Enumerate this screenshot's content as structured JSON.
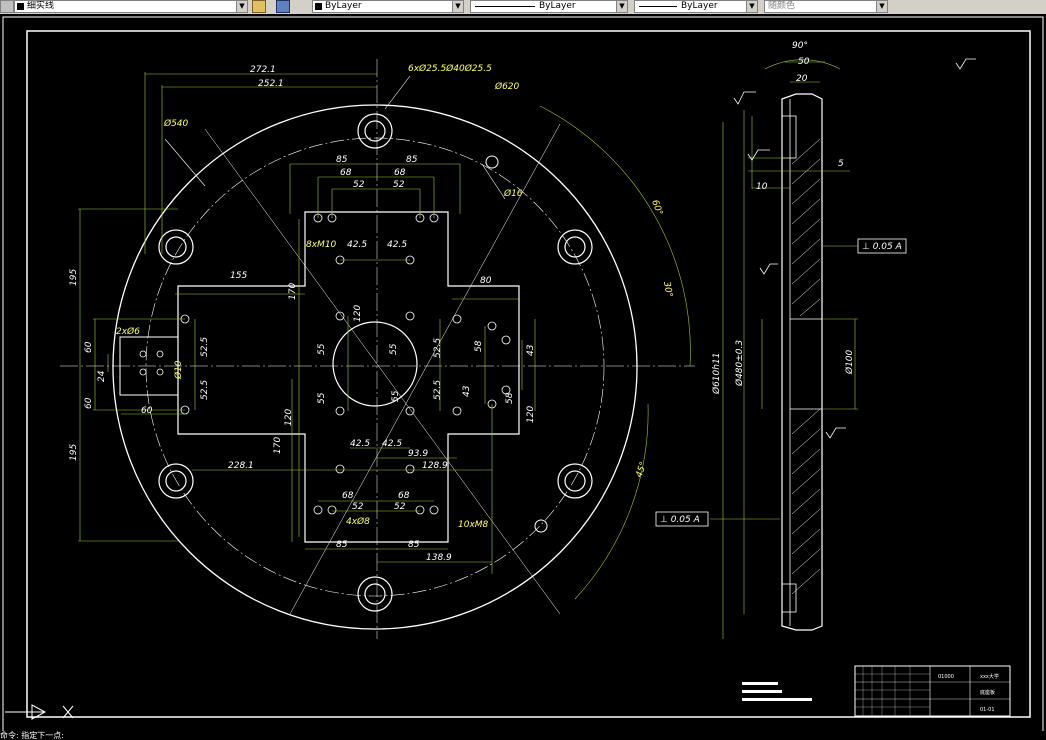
{
  "toolbar": {
    "layer_name": "细实线",
    "linetype": "ByLayer",
    "lineweight": "ByLayer",
    "plotstyle": "ByLayer",
    "color": "随颜色"
  },
  "status": {
    "text": "命令: 指定下一点:"
  },
  "drawing": {
    "front_view": {
      "dim_272": "272.1",
      "dim_252": "252.1",
      "holes_6x": "6xØ25.5Ø40Ø25.5",
      "dim_o620": "Ø620",
      "dim_o540": "Ø540",
      "dim_85a": "85",
      "dim_85b": "85",
      "dim_68a": "68",
      "dim_68b": "68",
      "dim_52a": "52",
      "dim_52b": "52",
      "dim_o16": "Ø16",
      "dim_60deg": "60°",
      "dim_8m10": "8xM10",
      "dim_42a": "42.5",
      "dim_42b": "42.5",
      "dim_195a": "195",
      "dim_155": "155",
      "dim_170a": "170",
      "dim_80": "80",
      "dim_30": "30°",
      "dim_120a": "120",
      "dim_60a": "60",
      "dim_52_5a": "52.5",
      "dim_55a": "55",
      "dim_55b": "55",
      "dim_52_5b": "52.5",
      "dim_58a": "58",
      "dim_43a": "43",
      "dim_2x6": "2xØ6",
      "dim_24": "24",
      "dim_o10": "Ø10",
      "dim_60b": "60",
      "dim_52_5c": "52.5",
      "dim_55c": "55",
      "dim_55d": "55",
      "dim_52_5d": "52.5",
      "dim_43b": "43",
      "dim_58b": "58",
      "dim_60c": "60",
      "dim_120b": "120",
      "dim_120c": "120",
      "dim_42c": "42.5",
      "dim_42d": "42.5",
      "dim_93": "93.9",
      "dim_195b": "195",
      "dim_228": "228.1",
      "dim_170b": "170",
      "dim_128": "128.9",
      "dim_45": "45°",
      "dim_68c": "68",
      "dim_68d": "68",
      "dim_52c": "52",
      "dim_52d": "52",
      "dim_4x8": "4xØ8",
      "dim_10m8": "10xM8",
      "dim_85c": "85",
      "dim_85d": "85",
      "dim_138": "138.9"
    },
    "side_view": {
      "dim_90": "90°",
      "dim_50": "50",
      "dim_20": "20",
      "dim_5": "5",
      "dim_10": "10",
      "tol_label_a": "⊥ 0.05 A",
      "dim_o610": "Ø610h11",
      "dim_o480": "Ø480±0.3",
      "dim_o100": "Ø100",
      "tol_label_b": "⊥ 0.05 A"
    },
    "title_block": {
      "scale": "01000",
      "school": "xxx大学",
      "part_name": "底座板",
      "drawing_no": "01-01"
    }
  },
  "colors": {
    "background": "#000000",
    "geometry": "#ffffff",
    "dimension": "#ffff66",
    "dimline": "#9acd32",
    "toolbar": "#d4d0c8"
  }
}
